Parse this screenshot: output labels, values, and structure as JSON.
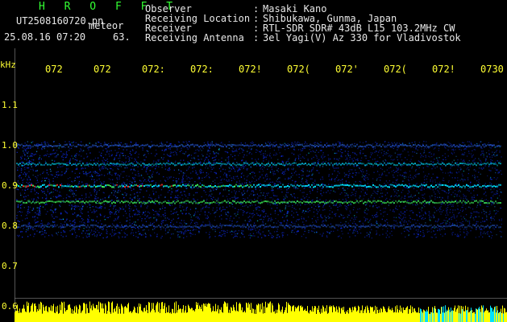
{
  "header": {
    "app_title": "H R O F F T",
    "filename": "UT2508160720.pn",
    "tag": "meteor",
    "datetime": "25.08.16 07:20",
    "count": "63."
  },
  "info": [
    {
      "label": "Observer",
      "value": "Masaki Kano"
    },
    {
      "label": "Receiving Location",
      "value": "Shibukawa, Gunma, Japan"
    },
    {
      "label": "Receiver",
      "value": "RTL-SDR SDR# 43dB L15 103.2MHz CW"
    },
    {
      "label": "Receiving Antenna",
      "value": "3el Yagi(V) Az 330 for Vladivostok"
    }
  ],
  "separator": ":",
  "axis": {
    "unit": "kHz",
    "y_ticks": [
      "1.1",
      "1.0",
      "0.9",
      "0.8",
      "0.7",
      "0.6"
    ],
    "x_ticks": [
      "072",
      "072",
      "072:",
      "072:",
      "072!",
      "072(",
      "072'",
      "072(",
      "072!",
      "0730"
    ]
  },
  "colors": {
    "background": "#000000",
    "label_yellow": "#ffff33",
    "title_green": "#33ff33",
    "text_white": "#e8e8e8",
    "noise_blue": "#1030ff",
    "band_cyan": "#00e0ff",
    "band_green": "#40ff60",
    "band_red": "#ff3030",
    "amplitude_bar": "#ffff00"
  }
}
